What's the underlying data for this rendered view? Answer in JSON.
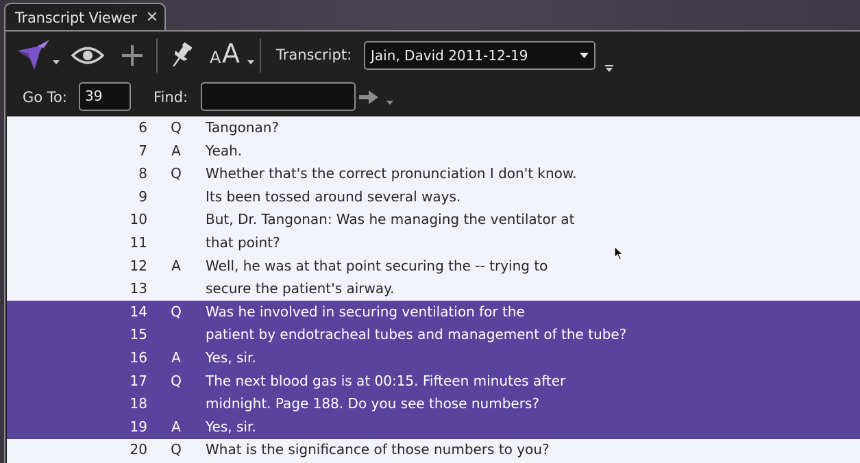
{
  "tab": {
    "title": "Transcript Viewer",
    "close_glyph": "✕",
    "close_icon": "close-icon"
  },
  "toolbar": {
    "logo_icon": "bird-logo-icon",
    "view_icon": "eye-icon",
    "add_icon": "plus-icon",
    "pin_icon": "pin-icon",
    "font_icon": "font-size-icon",
    "font_small_glyph": "A",
    "font_large_glyph": "A",
    "transcript_label": "Transcript:",
    "transcript_value": "Jain, David 2011-12-19",
    "goto_label": "Go To:",
    "goto_value": "39",
    "find_label": "Find:",
    "find_value": "",
    "find_go_icon": "arrow-right-icon",
    "overflow_icon": "overflow-caret-icon"
  },
  "colors": {
    "selection": "#5a439c",
    "content_background": "#f2f2fa",
    "toolbar_background": "#202020",
    "logo": "#7b52c7"
  },
  "transcript": {
    "lines": [
      {
        "num": "6",
        "speaker": "Q",
        "text": "Tangonan?",
        "selected": false
      },
      {
        "num": "7",
        "speaker": "A",
        "text": "Yeah.",
        "selected": false
      },
      {
        "num": "8",
        "speaker": "Q",
        "text": "Whether that's the correct pronunciation I don't know.",
        "selected": false
      },
      {
        "num": "9",
        "speaker": "",
        "text": "Its been tossed around several ways.",
        "selected": false
      },
      {
        "num": "10",
        "speaker": "",
        "text": "But, Dr. Tangonan:  Was he managing the ventilator at",
        "selected": false
      },
      {
        "num": "11",
        "speaker": "",
        "text": "that point?",
        "selected": false
      },
      {
        "num": "12",
        "speaker": "A",
        "text": "Well, he was at that point securing the -- trying to",
        "selected": false
      },
      {
        "num": "13",
        "speaker": "",
        "text": "secure the patient's airway.",
        "selected": false
      },
      {
        "num": "14",
        "speaker": "Q",
        "text": "Was he involved in securing ventilation for the",
        "selected": true
      },
      {
        "num": "15",
        "speaker": "",
        "text": "patient by endotracheal tubes and management of the tube?",
        "selected": true
      },
      {
        "num": "16",
        "speaker": "A",
        "text": "Yes, sir.",
        "selected": true
      },
      {
        "num": "17",
        "speaker": "Q",
        "text": "The next blood gas is at 00:15.  Fifteen minutes after",
        "selected": true
      },
      {
        "num": "18",
        "speaker": "",
        "text": "midnight.  Page 188.  Do you see those numbers?",
        "selected": true
      },
      {
        "num": "19",
        "speaker": "A",
        "text": "Yes, sir.",
        "selected": true
      },
      {
        "num": "20",
        "speaker": "Q",
        "text": "What is the significance of those numbers to you?",
        "selected": false
      }
    ]
  }
}
